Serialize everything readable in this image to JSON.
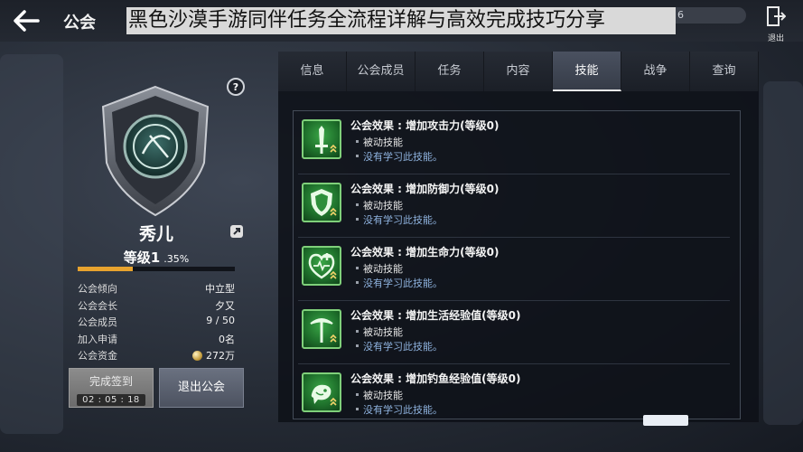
{
  "topbar": {
    "title": "公会",
    "banner": "黑色沙漠手游同伴任务全流程详解与高效完成技巧分享",
    "counter_text": "6",
    "exit_label": "退出"
  },
  "guild": {
    "name": "秀儿",
    "level_label": "等级1",
    "level_pct_text": ".35%",
    "level_progress": 0.35,
    "info": [
      {
        "label": "公会倾向",
        "value": "中立型"
      },
      {
        "label": "公会会长",
        "value": "夕又"
      },
      {
        "label": "公会成员",
        "value": "9 / 50"
      },
      {
        "label": "加入申请",
        "value": "0名"
      },
      {
        "label": "公会资金",
        "value": "272万"
      }
    ],
    "checkin_label": "完成签到",
    "checkin_timer": "02 : 05 : 18",
    "leave_label": "退出公会"
  },
  "tabs": [
    {
      "label": "信息"
    },
    {
      "label": "公会成员"
    },
    {
      "label": "任务"
    },
    {
      "label": "内容"
    },
    {
      "label": "技能",
      "active": true
    },
    {
      "label": "战争"
    },
    {
      "label": "查询"
    }
  ],
  "skills": [
    {
      "title": "公会效果 : 增加攻击力(等级0)",
      "type": "被动技能",
      "status": "没有学习此技能。",
      "icon": "sword-icon"
    },
    {
      "title": "公会效果 : 增加防御力(等级0)",
      "type": "被动技能",
      "status": "没有学习此技能。",
      "icon": "shield-icon"
    },
    {
      "title": "公会效果 : 增加生命力(等级0)",
      "type": "被动技能",
      "status": "没有学习此技能。",
      "icon": "heart-plus-icon"
    },
    {
      "title": "公会效果 : 增加生活经验值(等级0)",
      "type": "被动技能",
      "status": "没有学习此技能。",
      "icon": "pickaxe-icon"
    },
    {
      "title": "公会效果 : 增加钓鱼经验值(等级0)",
      "type": "被动技能",
      "status": "没有学习此技能。",
      "icon": "fish-icon"
    }
  ],
  "colors": {
    "accent": "#e8a32e",
    "skill_green": "#3aa646",
    "status_blue": "#8fb3df"
  }
}
